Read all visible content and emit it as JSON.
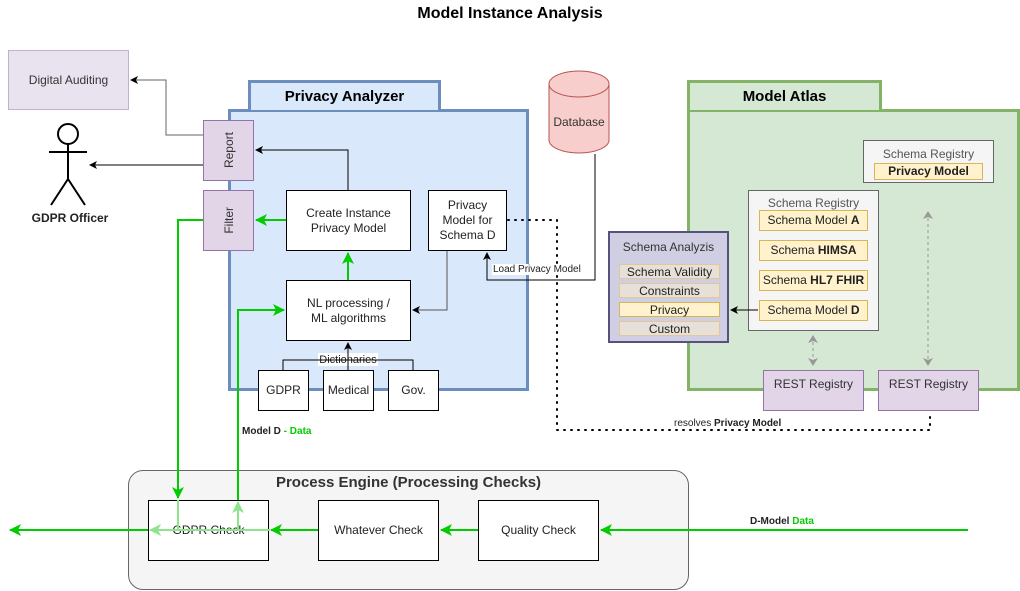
{
  "title": "Model Instance Analysis",
  "colors": {
    "flow_green": "#00cc00",
    "analyzer_fill": "#dae8fc",
    "analyzer_border": "#6c8ebf",
    "atlas_fill": "#d5e8d4",
    "atlas_border": "#82b366",
    "purple_fill": "#e1d5e7",
    "database_fill": "#f8cecc"
  },
  "actors": {
    "digital_auditing": "Digital Auditing",
    "gdpr_officer": "GDPR Officer"
  },
  "privacy_analyzer": {
    "title": "Privacy Analyzer",
    "report": "Report",
    "filter": "Filter",
    "create_instance": "Create Instance Privacy Model",
    "privacy_model_schema": "Privacy Model for Schema D",
    "nl_processing": "NL processing / ML algorithms",
    "dictionaries_label": "Dictionaries",
    "dictionaries": [
      "GDPR",
      "Medical",
      "Gov."
    ]
  },
  "database": {
    "label": "Database"
  },
  "edges": {
    "load_privacy_model": "Load Privacy Model",
    "resolves_prefix": "resolves ",
    "resolves_bold": "Privacy Model",
    "model_d": "Model D",
    "model_d_sep": " - ",
    "model_d_data": "Data",
    "d_model": "D-Model",
    "d_model_data": "Data"
  },
  "schema_analyzis": {
    "title": "Schema Analyzis",
    "items": [
      "Schema Validity",
      "Constraints",
      "Privacy",
      "Custom"
    ],
    "highlighted": "Privacy"
  },
  "model_atlas": {
    "title": "Model Atlas",
    "registry_back": {
      "title": "Schema Registry",
      "items": [
        {
          "prefix": "",
          "bold": "Privacy Model"
        }
      ]
    },
    "registry_front": {
      "title": "Schema Registry",
      "items": [
        {
          "prefix": "Schema Model ",
          "bold": "A"
        },
        {
          "prefix": "Schema ",
          "bold": "HIMSA"
        },
        {
          "prefix": "Schema ",
          "bold": "HL7 FHIR"
        },
        {
          "prefix": "Schema Model ",
          "bold": "D"
        }
      ]
    },
    "rest_registries": [
      "REST Registry",
      "REST Registry"
    ]
  },
  "process_engine": {
    "title": "Process Engine (Processing Checks)",
    "checks": [
      "GDPR Check",
      "Whatever Check",
      "Quality Check"
    ]
  }
}
